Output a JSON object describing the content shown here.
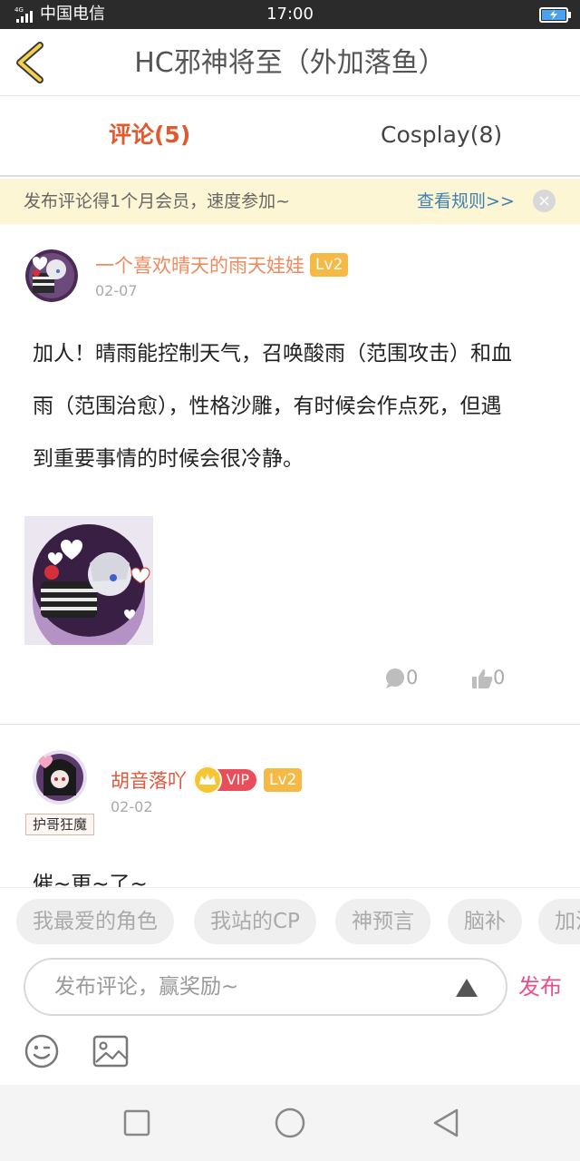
{
  "status_bar": {
    "network": "4G",
    "carrier": "中国电信",
    "time": "17:00"
  },
  "header": {
    "title": "HC邪神将至（外加落鱼）",
    "back_icon": "chevron-left-icon"
  },
  "tabs": [
    {
      "label": "评论(5)",
      "active": true
    },
    {
      "label": "Cosplay(8)",
      "active": false
    }
  ],
  "notice": {
    "text": "发布评论得1个月会员，速度参加~",
    "link": "查看规则>>",
    "close_icon": "close-icon"
  },
  "comments": [
    {
      "username": "一个喜欢晴天的雨天娃娃",
      "username_color": "#f08a5d",
      "level": "Lv2",
      "date": "02-07",
      "lines": [
        "加人！晴雨能控制天气，召唤酸雨（范围攻击）和血",
        "雨（范围治愈），性格沙雕，有时候会作点死，但遇",
        "到重要事情的时候会很冷静。"
      ],
      "reply_count": "0",
      "like_count": "0"
    },
    {
      "username": "胡音落吖",
      "username_color": "#e0573b",
      "vip": "VIP",
      "level": "Lv2",
      "date": "02-02",
      "title_tag": "护哥狂魔",
      "text_partial": "催~更~了~"
    }
  ],
  "quick_tags": [
    "我最爱的角色",
    "我站的CP",
    "神预言",
    "脑补",
    "加油"
  ],
  "composer": {
    "placeholder": "发布评论，赢奖励~",
    "send_label": "发布",
    "emoji_icon": "emoji-icon",
    "image_icon": "image-icon"
  },
  "colors": {
    "accent_orange": "#e05a2f",
    "link_blue": "#3f7fb4",
    "notice_bg": "#fdf6d4",
    "level_badge": "#f5b945",
    "vip_red": "#e94e5b",
    "send_pink": "#e8508c"
  }
}
